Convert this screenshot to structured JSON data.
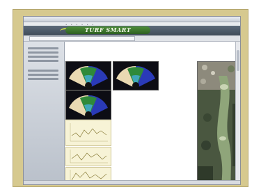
{
  "app": {
    "title": "",
    "brand": "TURF SMART"
  },
  "sidebar": {
    "sections": [
      "",
      ""
    ],
    "item_count": 8
  },
  "colors": {
    "frame": "#d6c98f",
    "banner": "#4a5766",
    "logo_green": "#3d7a2e",
    "accent_yellow": "#c8d94a"
  },
  "content": {
    "thumbnails": 3,
    "graphs": 3
  }
}
